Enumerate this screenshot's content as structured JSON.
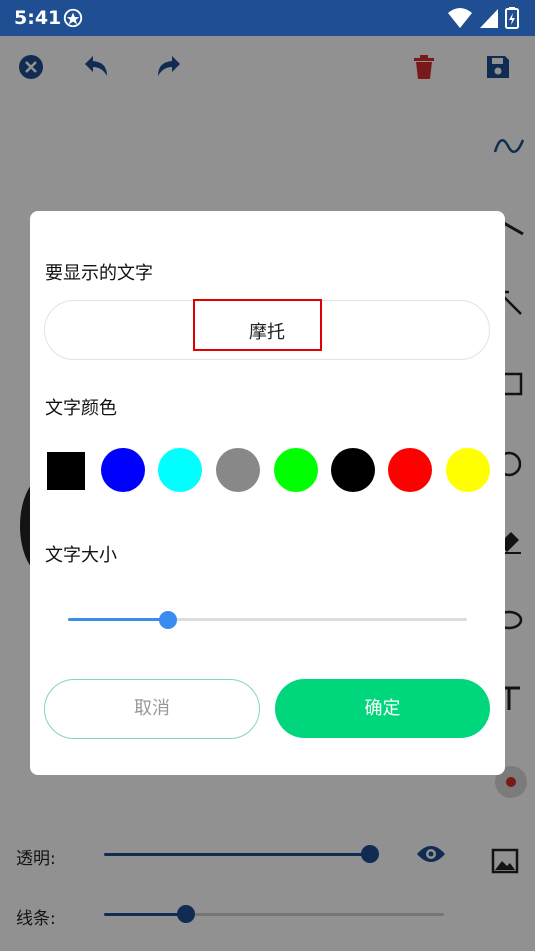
{
  "status_bar": {
    "time": "5:41",
    "icons": [
      "app-badge-icon",
      "wifi-icon",
      "signal-icon",
      "battery-charging-icon"
    ]
  },
  "toolbar": {
    "buttons": [
      "close-icon",
      "undo-icon",
      "redo-icon",
      "delete-icon",
      "save-icon"
    ]
  },
  "side_tools": [
    "curve-icon",
    "line-icon",
    "arrow-icon",
    "rectangle-icon",
    "circle-icon",
    "eraser-icon",
    "oval-icon",
    "text-icon",
    "palette-icon",
    "image-icon"
  ],
  "bottom_panel": {
    "opacity_label": "透明:",
    "opacity_value": 0.97,
    "line_label": "线条:",
    "line_value": 0.24,
    "eye_icon": "eye-icon"
  },
  "dialog": {
    "text_label": "要显示的文字",
    "text_value": "摩托",
    "color_label": "文字颜色",
    "colors": [
      "#000000",
      "#0000ff",
      "#00ffff",
      "#888888",
      "#00ff00",
      "#000000",
      "#ff0000",
      "#ffff00"
    ],
    "size_label": "文字大小",
    "size_value": 0.25,
    "cancel_label": "取消",
    "ok_label": "确定",
    "accent_color": "#00d77c"
  },
  "colors": {
    "primary": "#1f4e93",
    "delete_red": "#d32f2f",
    "slider_blue": "#3b8cf0"
  }
}
